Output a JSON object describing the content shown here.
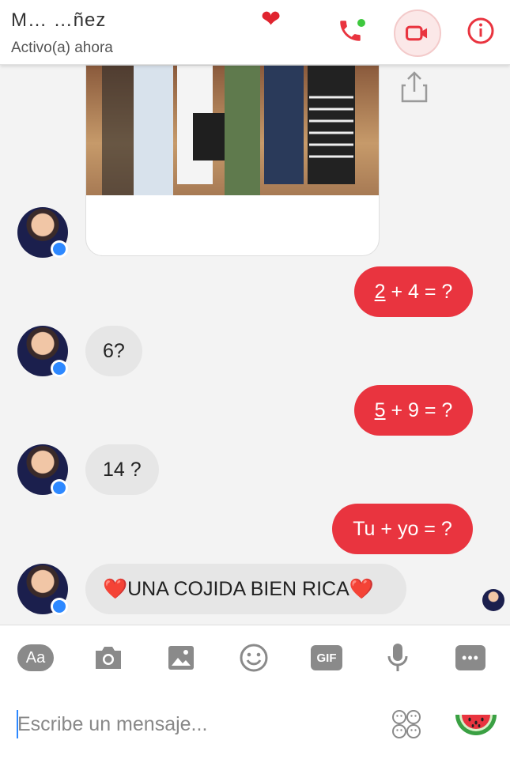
{
  "header": {
    "name": "M… …ñez",
    "status": "Activo(a) ahora"
  },
  "messages": [
    {
      "side": "out",
      "text_underlined": "2",
      "text_rest": " + 4 = ?"
    },
    {
      "side": "in",
      "text": "6?"
    },
    {
      "side": "out",
      "text_underlined": "5",
      "text_rest": " + 9 = ?"
    },
    {
      "side": "in",
      "text": "14 ?"
    },
    {
      "side": "out",
      "text": "Tu + yo = ?"
    },
    {
      "side": "in",
      "text": "❤️UNA COJIDA BIEN RICA❤️"
    }
  ],
  "toolbar": {
    "aa_label": "Aa",
    "gif_label": "GIF",
    "more_label": "•••"
  },
  "composer": {
    "placeholder": "Escribe un mensaje..."
  },
  "icons": {
    "call": "phone-icon",
    "video": "video-camera-icon",
    "info": "info-icon",
    "share": "share-icon",
    "camera": "camera-icon",
    "image": "image-icon",
    "emoji": "smiley-icon",
    "mic": "microphone-icon",
    "stickers": "sticker-icon",
    "watermelon": "watermelon-icon"
  },
  "colors": {
    "accent": "#e9343f",
    "incoming_bubble": "#e6e6e6",
    "messenger_blue": "#2d88ff",
    "online": "#3ec83e"
  }
}
